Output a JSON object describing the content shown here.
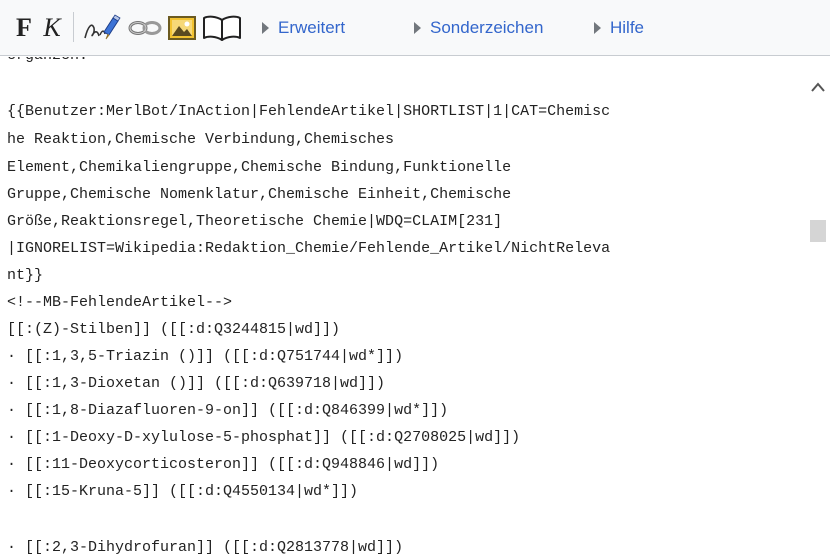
{
  "toolbar": {
    "bold_label": "F",
    "italic_label": "K",
    "icons": [
      "signature-icon",
      "link-icon",
      "picture-icon",
      "book-icon"
    ],
    "tabs": [
      {
        "label": "Erweitert"
      },
      {
        "label": "Sonderzeichen"
      },
      {
        "label": "Hilfe"
      }
    ],
    "link_color": "#3366cc"
  },
  "editor": {
    "lines": [
      "ergänzen:",
      "",
      "{{Benutzer:MerlBot/InAction|FehlendeArtikel|SHORTLIST|1|CAT=Chemisc",
      "he Reaktion,Chemische Verbindung,Chemisches",
      "Element,Chemikaliengruppe,Chemische Bindung,Funktionelle",
      "Gruppe,Chemische Nomenklatur,Chemische Einheit,Chemische",
      "Größe,Reaktionsregel,Theoretische Chemie|WDQ=CLAIM[231]",
      "|IGNORELIST=Wikipedia:Redaktion_Chemie/Fehlende_Artikel/NichtReleva",
      "nt}}",
      "<!--MB-FehlendeArtikel-->",
      "[[:(Z)-Stilben]] ([[:d:Q3244815|wd]])",
      "· [[:1,3,5-Triazin ()]] ([[:d:Q751744|wd*]])",
      "· [[:1,3-Dioxetan ()]] ([[:d:Q639718|wd]])",
      "· [[:1,8-Diazafluoren-9-on]] ([[:d:Q846399|wd*]])",
      "· [[:1-Deoxy-D-xylulose-5-phosphat]] ([[:d:Q2708025|wd]])",
      "· [[:11-Deoxycorticosteron]] ([[:d:Q948846|wd]])",
      "· [[:15-Kruna-5]] ([[:d:Q4550134|wd*]])",
      "· [[:2,3-Dihydrofuran]] ([[:d:Q2813778|wd]])"
    ]
  }
}
